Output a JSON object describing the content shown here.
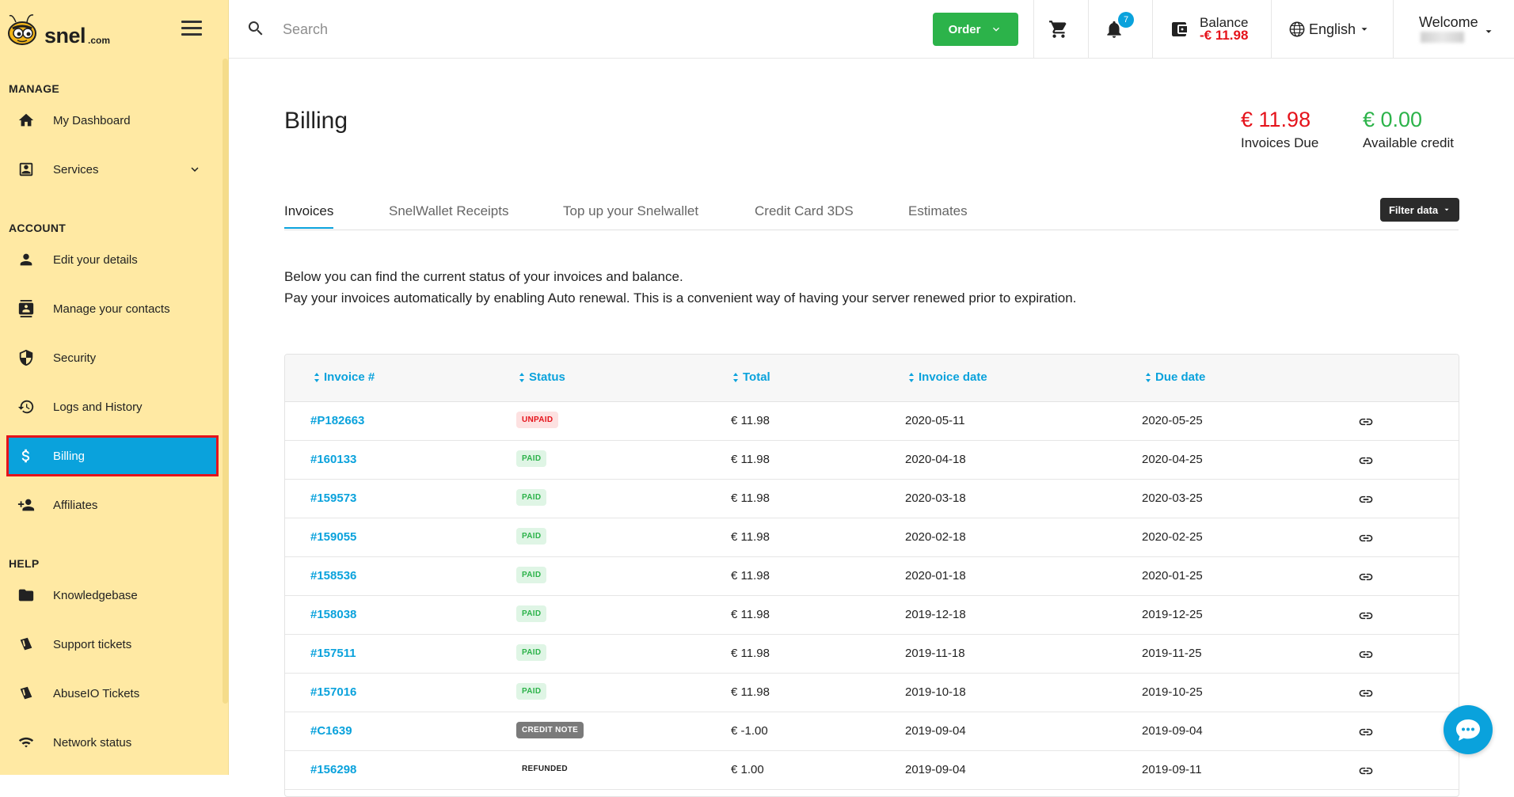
{
  "brand": {
    "name": "snel",
    "suffix": ".com"
  },
  "sidebar": {
    "sections": [
      {
        "label": "MANAGE"
      },
      {
        "label": "ACCOUNT"
      },
      {
        "label": "HELP"
      }
    ],
    "items": [
      {
        "label": "My Dashboard",
        "icon": "home-icon"
      },
      {
        "label": "Services",
        "icon": "services-icon"
      },
      {
        "label": "Edit your details",
        "icon": "person-icon"
      },
      {
        "label": "Manage your contacts",
        "icon": "contacts-icon"
      },
      {
        "label": "Security",
        "icon": "shield-icon"
      },
      {
        "label": "Logs and History",
        "icon": "history-icon"
      },
      {
        "label": "Billing",
        "icon": "dollar-icon",
        "active": true
      },
      {
        "label": "Affiliates",
        "icon": "affiliates-icon"
      },
      {
        "label": "Knowledgebase",
        "icon": "folder-icon"
      },
      {
        "label": "Support tickets",
        "icon": "tickets-icon"
      },
      {
        "label": "AbuseIO Tickets",
        "icon": "abuse-tickets-icon"
      },
      {
        "label": "Network status",
        "icon": "network-icon"
      }
    ]
  },
  "topbar": {
    "search_placeholder": "Search",
    "order_label": "Order",
    "notifications_count": "7",
    "balance_label": "Balance",
    "balance_value": "-€ 11.98",
    "language": "English",
    "welcome": "Welcome"
  },
  "main": {
    "title": "Billing",
    "invoices_due_amount": "€ 11.98",
    "invoices_due_label": "Invoices Due",
    "available_credit_amount": "€ 0.00",
    "available_credit_label": "Available credit",
    "tabs": [
      {
        "label": "Invoices",
        "active": true
      },
      {
        "label": "SnelWallet Receipts"
      },
      {
        "label": "Top up your Snelwallet"
      },
      {
        "label": "Credit Card 3DS"
      },
      {
        "label": "Estimates"
      }
    ],
    "filter_label": "Filter data",
    "intro_line1": "Below you can find the current status of your invoices and balance.",
    "intro_line2": "Pay your invoices automatically by enabling Auto renewal. This is a convenient way of having your server renewed prior to expiration."
  },
  "table": {
    "columns": [
      "Invoice #",
      "Status",
      "Total",
      "Invoice date",
      "Due date"
    ],
    "rows": [
      {
        "invoice": "#P182663",
        "status": "UNPAID",
        "status_type": "unpaid",
        "total": "€ 11.98",
        "invoice_date": "2020-05-11",
        "due_date": "2020-05-25"
      },
      {
        "invoice": "#160133",
        "status": "PAID",
        "status_type": "paid",
        "total": "€ 11.98",
        "invoice_date": "2020-04-18",
        "due_date": "2020-04-25"
      },
      {
        "invoice": "#159573",
        "status": "PAID",
        "status_type": "paid",
        "total": "€ 11.98",
        "invoice_date": "2020-03-18",
        "due_date": "2020-03-25"
      },
      {
        "invoice": "#159055",
        "status": "PAID",
        "status_type": "paid",
        "total": "€ 11.98",
        "invoice_date": "2020-02-18",
        "due_date": "2020-02-25"
      },
      {
        "invoice": "#158536",
        "status": "PAID",
        "status_type": "paid",
        "total": "€ 11.98",
        "invoice_date": "2020-01-18",
        "due_date": "2020-01-25"
      },
      {
        "invoice": "#158038",
        "status": "PAID",
        "status_type": "paid",
        "total": "€ 11.98",
        "invoice_date": "2019-12-18",
        "due_date": "2019-12-25"
      },
      {
        "invoice": "#157511",
        "status": "PAID",
        "status_type": "paid",
        "total": "€ 11.98",
        "invoice_date": "2019-11-18",
        "due_date": "2019-11-25"
      },
      {
        "invoice": "#157016",
        "status": "PAID",
        "status_type": "paid",
        "total": "€ 11.98",
        "invoice_date": "2019-10-18",
        "due_date": "2019-10-25"
      },
      {
        "invoice": "#C1639",
        "status": "CREDIT NOTE",
        "status_type": "credit",
        "total": "€ -1.00",
        "invoice_date": "2019-09-04",
        "due_date": "2019-09-04"
      },
      {
        "invoice": "#156298",
        "status": "REFUNDED",
        "status_type": "refunded",
        "total": "€ 1.00",
        "invoice_date": "2019-09-04",
        "due_date": "2019-09-11"
      }
    ]
  },
  "colors": {
    "sidebar_bg": "#ffe9a3",
    "accent": "#0aa2dc",
    "success": "#2cb34a",
    "danger": "#e5131b"
  }
}
